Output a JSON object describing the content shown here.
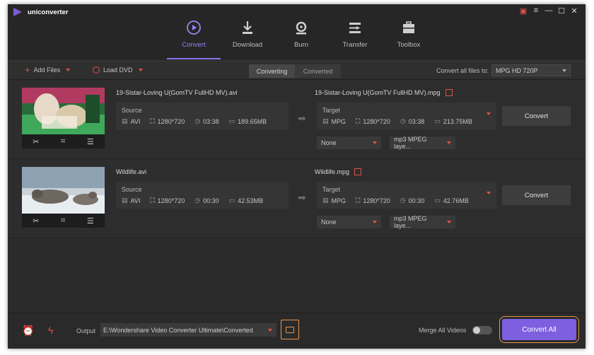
{
  "app": {
    "title": "uniconverter"
  },
  "nav": [
    {
      "label": "Convert",
      "icon": "convert-icon",
      "active": true
    },
    {
      "label": "Download",
      "icon": "download-icon",
      "active": false
    },
    {
      "label": "Burn",
      "icon": "burn-icon",
      "active": false
    },
    {
      "label": "Transfer",
      "icon": "transfer-icon",
      "active": false
    },
    {
      "label": "Toolbox",
      "icon": "toolbox-icon",
      "active": false
    }
  ],
  "toolbar": {
    "add_files": "Add Files",
    "load_dvd": "Load DVD",
    "tab_converting": "Converting",
    "tab_converted": "Converted",
    "convert_all_to_label": "Convert all files to:",
    "format": "MPG HD 720P"
  },
  "files": [
    {
      "source_name": "19-Sistar-Loving U(GomTV FullHD MV).avi",
      "source_label": "Source",
      "source": {
        "format": "AVI",
        "resolution": "1280*720",
        "duration": "03:38",
        "size": "189.65MB"
      },
      "target_name": "19-Sistar-Loving U(GomTV FullHD MV).mpg",
      "target_label": "Target",
      "target": {
        "format": "MPG",
        "resolution": "1280*720",
        "duration": "03:38",
        "size": "213.75MB"
      },
      "subtitle": "None",
      "audio": "mp3 MPEG laye...",
      "convert": "Convert"
    },
    {
      "source_name": "Wildlife.avi",
      "source_label": "Source",
      "source": {
        "format": "AVI",
        "resolution": "1280*720",
        "duration": "00:30",
        "size": "42.53MB"
      },
      "target_name": "Wildlife.mpg",
      "target_label": "Target",
      "target": {
        "format": "MPG",
        "resolution": "1280*720",
        "duration": "00:30",
        "size": "42.76MB"
      },
      "subtitle": "None",
      "audio": "mp3 MPEG laye...",
      "convert": "Convert"
    }
  ],
  "bottom": {
    "output_label": "Output",
    "output_path": "E:\\Wondershare Video Converter Ultimate\\Converted",
    "merge_label": "Merge All Videos",
    "merge_on": false,
    "convert_all": "Convert All"
  },
  "colors": {
    "accent": "#7d5fe0",
    "highlight": "#e8954a",
    "red": "#e0524a"
  }
}
